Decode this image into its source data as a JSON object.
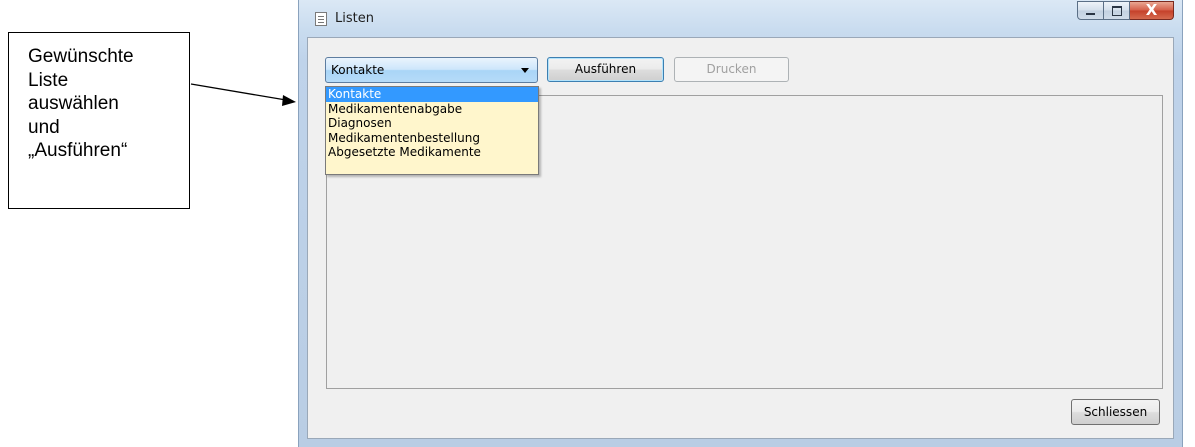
{
  "callout": {
    "lines": [
      "Gewünschte",
      "Liste",
      "auswählen",
      "und",
      "„Ausführen“"
    ]
  },
  "window": {
    "title": "Listen",
    "close_glyph": "X"
  },
  "toolbar": {
    "combo_value": "Kontakte",
    "run_label": "Ausführen",
    "print_label": "Drucken"
  },
  "dropdown": {
    "items": [
      {
        "label": "Kontakte",
        "selected": true
      },
      {
        "label": "Medikamentenabgabe",
        "selected": false
      },
      {
        "label": "Diagnosen",
        "selected": false
      },
      {
        "label": "Medikamentenbestellung",
        "selected": false
      },
      {
        "label": "Abgesetzte Medikamente",
        "selected": false
      }
    ]
  },
  "footer": {
    "close_label": "Schliessen"
  },
  "colors": {
    "selection": "#3399ff",
    "dropdown_bg": "#fff6cc",
    "close_button": "#c5402a"
  }
}
